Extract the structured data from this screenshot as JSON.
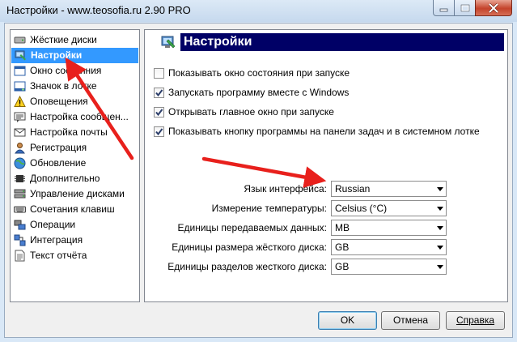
{
  "window": {
    "title": "Настройки  -  www.teosofia.ru 2.90 PRO"
  },
  "nav": {
    "items": [
      {
        "label": "Жёсткие диски",
        "icon": "hdd-icon"
      },
      {
        "label": "Настройки",
        "icon": "settings-icon",
        "active": true
      },
      {
        "label": "Окно состояния",
        "icon": "window-icon"
      },
      {
        "label": "Значок в лотке",
        "icon": "tray-icon"
      },
      {
        "label": "Оповещения",
        "icon": "warning-icon"
      },
      {
        "label": "Настройка сообщен...",
        "icon": "message-icon"
      },
      {
        "label": "Настройка почты",
        "icon": "mail-icon"
      },
      {
        "label": "Регистрация",
        "icon": "user-icon"
      },
      {
        "label": "Обновление",
        "icon": "globe-icon"
      },
      {
        "label": "Дополнительно",
        "icon": "chip-icon"
      },
      {
        "label": "Управление дисками",
        "icon": "disk-manage-icon"
      },
      {
        "label": "Сочетания клавиш",
        "icon": "keyboard-icon"
      },
      {
        "label": "Операции",
        "icon": "operations-icon"
      },
      {
        "label": "Интеграция",
        "icon": "integration-icon"
      },
      {
        "label": "Текст отчёта",
        "icon": "report-icon"
      }
    ]
  },
  "panel": {
    "title": "Настройки",
    "checkboxes": [
      {
        "label": "Показывать окно состояния при запуске",
        "checked": false
      },
      {
        "label": "Запускать программу вместе с Windows",
        "checked": true
      },
      {
        "label": "Открывать главное окно при запуске",
        "checked": true
      },
      {
        "label": "Показывать кнопку программы на панели задач и в системном лотке",
        "checked": true
      }
    ],
    "settings": [
      {
        "label": "Язык интерфейса:",
        "value": "Russian"
      },
      {
        "label": "Измерение температуры:",
        "value": "Celsius (°C)"
      },
      {
        "label": "Единицы передаваемых данных:",
        "value": "MB"
      },
      {
        "label": "Единицы размера жёсткого диска:",
        "value": "GB"
      },
      {
        "label": "Единицы разделов жесткого диска:",
        "value": "GB"
      }
    ]
  },
  "buttons": {
    "ok": "OK",
    "cancel": "Отмена",
    "help": "Справка"
  },
  "colors": {
    "banner": "#000066",
    "selection": "#3399ff",
    "arrow": "#e8201c"
  }
}
